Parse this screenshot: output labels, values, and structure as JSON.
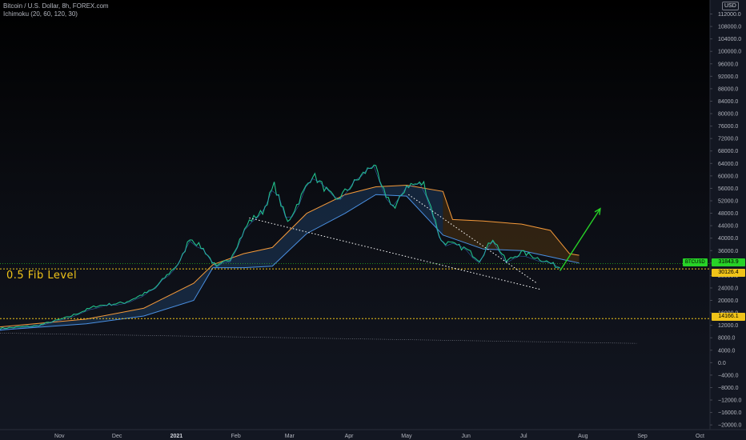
{
  "header": {
    "symbol_line": "Bitcoin / U.S. Dollar, 8h, FOREX.com",
    "indicator_line": "Ichimoku (20, 60, 120, 30)"
  },
  "fib_label": "0.5 Fib Level",
  "currency": "USD",
  "price_tags": {
    "symbol": "BTCUSD",
    "last": "31843.9",
    "level_a": "30126.4",
    "level_b": "14166.1"
  },
  "colors": {
    "price": "#21c08b",
    "price_down": "#3d7be0",
    "kumo_upper_line": "#f59a3a",
    "kumo_lower_line": "#4a90e2",
    "kumo_fill_bull": "#1d3a5c",
    "kumo_fill_bear": "#4a3010",
    "fib_line": "#f0c419",
    "arrow": "#27d227",
    "trendline": "#ffffff"
  },
  "chart_data": {
    "type": "line",
    "x_axis": {
      "ticks": [
        "Nov",
        "Dec",
        "2021",
        "Feb",
        "Mar",
        "Apr",
        "May",
        "Jun",
        "Jul",
        "Aug",
        "Sep",
        "Oct"
      ],
      "range": [
        "2020-10-01",
        "2021-10-25"
      ]
    },
    "y_axis": {
      "ticks": [
        -20000,
        -16000,
        -12000,
        -8000,
        -4000,
        0,
        4000,
        8000,
        12000,
        16000,
        20000,
        24000,
        28000,
        32000,
        36000,
        40000,
        44000,
        48000,
        52000,
        56000,
        60000,
        64000,
        68000,
        72000,
        76000,
        80000,
        84000,
        88000,
        92000,
        96000,
        100000,
        104000,
        108000,
        112000
      ],
      "ylim": [
        -21500,
        116500
      ],
      "tick_format": "one_decimal"
    },
    "series": [
      {
        "kind": "price",
        "x": [
          "2020-10-01",
          "2020-10-20",
          "2020-11-05",
          "2020-11-20",
          "2020-12-05",
          "2020-12-20",
          "2021-01-03",
          "2021-01-08",
          "2021-01-15",
          "2021-01-22",
          "2021-01-29",
          "2021-02-08",
          "2021-02-15",
          "2021-02-21",
          "2021-02-28",
          "2021-03-13",
          "2021-03-25",
          "2021-04-05",
          "2021-04-14",
          "2021-04-18",
          "2021-04-25",
          "2021-05-01",
          "2021-05-10",
          "2021-05-15",
          "2021-05-19",
          "2021-05-25",
          "2021-06-01",
          "2021-06-08",
          "2021-06-15",
          "2021-06-22",
          "2021-06-30",
          "2021-07-06",
          "2021-07-13",
          "2021-07-20"
        ],
        "values": [
          11000,
          11800,
          14500,
          18200,
          19300,
          23500,
          32500,
          40200,
          36500,
          30500,
          33500,
          45500,
          48500,
          57000,
          45000,
          60500,
          52000,
          58500,
          64000,
          56000,
          49500,
          57000,
          57500,
          47500,
          39000,
          38000,
          36500,
          33000,
          40000,
          32500,
          35500,
          34200,
          32500,
          30500
        ]
      },
      {
        "kind": "kumo_upper",
        "x": [
          "2020-10-01",
          "2020-11-15",
          "2020-12-15",
          "2021-01-10",
          "2021-01-20",
          "2021-02-05",
          "2021-02-20",
          "2021-03-10",
          "2021-03-30",
          "2021-04-15",
          "2021-05-01",
          "2021-05-20",
          "2021-05-25",
          "2021-06-10",
          "2021-06-30",
          "2021-07-15",
          "2021-07-25",
          "2021-07-30"
        ],
        "values": [
          11500,
          14000,
          17500,
          25500,
          31500,
          35000,
          37000,
          48000,
          54000,
          56500,
          57000,
          55000,
          46000,
          45500,
          44500,
          42500,
          35000,
          34500
        ]
      },
      {
        "kind": "kumo_lower",
        "x": [
          "2020-10-01",
          "2020-11-15",
          "2020-12-15",
          "2021-01-10",
          "2021-01-20",
          "2021-02-05",
          "2021-02-20",
          "2021-03-10",
          "2021-03-30",
          "2021-04-15",
          "2021-05-01",
          "2021-05-20",
          "2021-06-10",
          "2021-06-30",
          "2021-07-15",
          "2021-07-30"
        ],
        "values": [
          10500,
          12500,
          15000,
          20000,
          30500,
          30500,
          31000,
          41500,
          48000,
          54000,
          53500,
          41000,
          36500,
          36000,
          34000,
          32000
        ]
      }
    ],
    "horizontal_levels": [
      30126.4,
      14166.1,
      31843.9
    ],
    "annotations": {
      "trendlines": [
        {
          "from": [
            "2021-02-08",
            46500
          ],
          "to": [
            "2021-07-10",
            23500
          ]
        },
        {
          "from": [
            "2021-05-02",
            54000
          ],
          "to": [
            "2021-07-08",
            25500
          ]
        }
      ],
      "arrow": {
        "from": [
          "2021-07-20",
          29500
        ],
        "to": [
          "2021-08-10",
          49500
        ]
      },
      "long_trend": {
        "from": [
          "2020-10-01",
          9500
        ],
        "to": [
          "2021-08-29",
          6200
        ]
      }
    }
  }
}
